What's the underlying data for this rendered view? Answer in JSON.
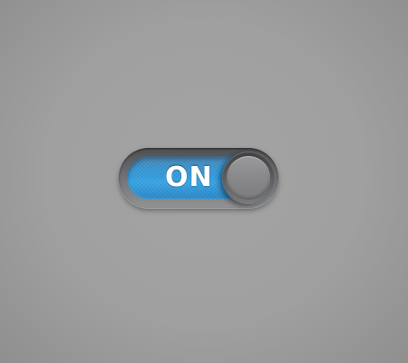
{
  "toggle": {
    "state_label": "ON",
    "is_on": true,
    "track_color": "#2f95d6",
    "knob_color": "#8a8a8c",
    "background_color": "#a0a0a0"
  }
}
